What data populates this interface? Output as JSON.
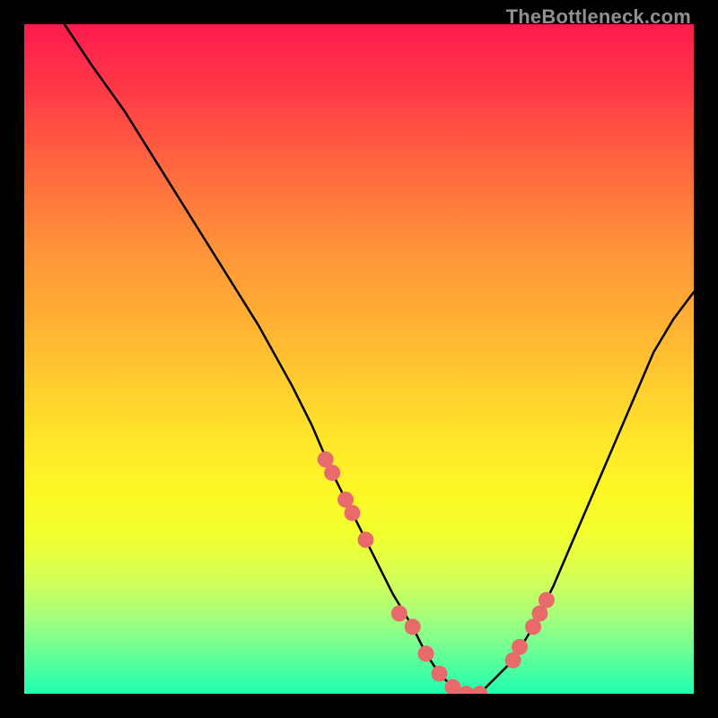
{
  "watermark": "TheBottleneck.com",
  "chart_data": {
    "type": "line",
    "title": "",
    "xlabel": "",
    "ylabel": "",
    "xlim": [
      0,
      100
    ],
    "ylim": [
      0,
      100
    ],
    "series": [
      {
        "name": "bottleneck-curve",
        "x": [
          6,
          10,
          15,
          20,
          25,
          30,
          35,
          40,
          43,
          46,
          49,
          52,
          55,
          58,
          60,
          62,
          64,
          66,
          68,
          70,
          73,
          76,
          79,
          82,
          85,
          88,
          91,
          94,
          97,
          100
        ],
        "y": [
          100,
          94,
          87,
          79,
          71,
          63,
          55,
          46,
          40,
          33,
          27,
          21,
          15,
          10,
          6,
          3,
          1,
          0,
          0,
          2,
          5,
          10,
          16,
          23,
          30,
          37,
          44,
          51,
          56,
          60
        ]
      }
    ],
    "markers": {
      "name": "highlight-points",
      "color": "#e86a6a",
      "x": [
        45,
        46,
        48,
        49,
        51,
        56,
        58,
        60,
        62,
        64,
        66,
        68,
        73,
        74,
        76,
        77,
        78
      ],
      "y": [
        35,
        33,
        29,
        27,
        23,
        12,
        10,
        6,
        3,
        1,
        0,
        0,
        5,
        7,
        10,
        12,
        14
      ]
    },
    "gradient_stops": [
      {
        "pos": 0.0,
        "color": "#ff1a4d"
      },
      {
        "pos": 0.1,
        "color": "#ff3a47"
      },
      {
        "pos": 0.22,
        "color": "#ff6a3e"
      },
      {
        "pos": 0.33,
        "color": "#ff923a"
      },
      {
        "pos": 0.45,
        "color": "#ffb233"
      },
      {
        "pos": 0.55,
        "color": "#ffd12e"
      },
      {
        "pos": 0.63,
        "color": "#ffe92a"
      },
      {
        "pos": 0.7,
        "color": "#fdf726"
      },
      {
        "pos": 0.76,
        "color": "#f2ff2e"
      },
      {
        "pos": 0.8,
        "color": "#e2ff45"
      },
      {
        "pos": 0.84,
        "color": "#cbff5e"
      },
      {
        "pos": 0.88,
        "color": "#aaff78"
      },
      {
        "pos": 0.92,
        "color": "#7fff8e"
      },
      {
        "pos": 0.96,
        "color": "#4fffa0"
      },
      {
        "pos": 1.0,
        "color": "#1effb0"
      }
    ]
  }
}
